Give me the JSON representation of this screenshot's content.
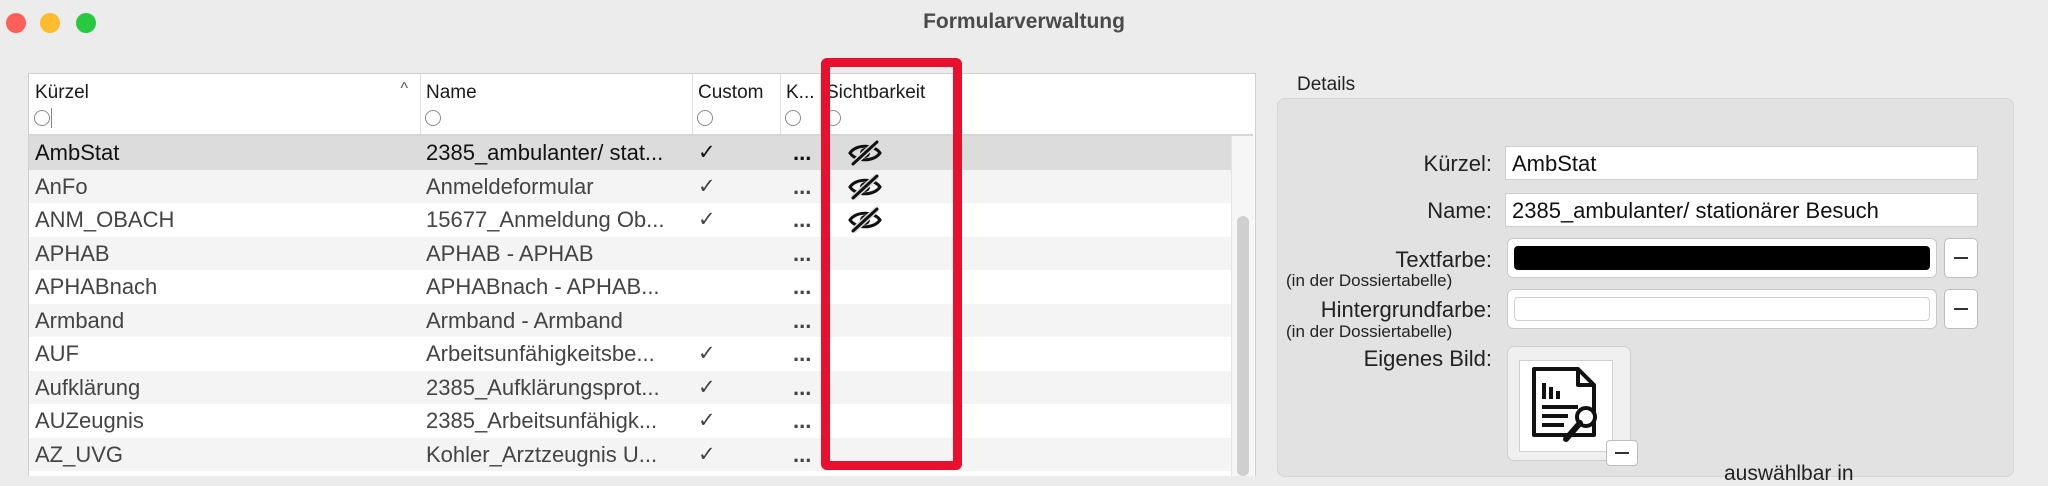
{
  "window": {
    "title": "Formularverwaltung"
  },
  "table": {
    "columns": [
      {
        "label": "Kürzel"
      },
      {
        "label": "Name"
      },
      {
        "label": "Custom"
      },
      {
        "label": "K..."
      },
      {
        "label": "Sichtbarkeit"
      }
    ],
    "rows": [
      {
        "kuerzel": "AmbStat",
        "name": "2385_ambulanter/ stat...",
        "custom": "✓",
        "k": "...",
        "hidden_icon": "eye-slash-icon"
      },
      {
        "kuerzel": "AnFo",
        "name": "Anmeldeformular",
        "custom": "✓",
        "k": "...",
        "hidden_icon": "eye-slash-icon"
      },
      {
        "kuerzel": "ANM_OBACH",
        "name": "15677_Anmeldung Ob...",
        "custom": "✓",
        "k": "...",
        "hidden_icon": "eye-slash-icon"
      },
      {
        "kuerzel": "APHAB",
        "name": "APHAB - APHAB",
        "custom": "",
        "k": "...",
        "hidden_icon": ""
      },
      {
        "kuerzel": "APHABnach",
        "name": "APHABnach - APHAB...",
        "custom": "",
        "k": "...",
        "hidden_icon": ""
      },
      {
        "kuerzel": "Armband",
        "name": "Armband - Armband",
        "custom": "",
        "k": "...",
        "hidden_icon": ""
      },
      {
        "kuerzel": "AUF",
        "name": "Arbeitsunfähigkeitsbe...",
        "custom": "✓",
        "k": "...",
        "hidden_icon": ""
      },
      {
        "kuerzel": "Aufklärung",
        "name": "2385_Aufklärungsprot...",
        "custom": "✓",
        "k": "...",
        "hidden_icon": ""
      },
      {
        "kuerzel": "AUZeugnis",
        "name": "2385_Arbeitsunfähigk...",
        "custom": "✓",
        "k": "...",
        "hidden_icon": ""
      },
      {
        "kuerzel": "AZ_UVG",
        "name": "Kohler_Arztzeugnis U...",
        "custom": "✓",
        "k": "...",
        "hidden_icon": ""
      }
    ]
  },
  "details": {
    "group_label": "Details",
    "kuerzel_label": "Kürzel:",
    "kuerzel_value": "AmbStat",
    "name_label": "Name:",
    "name_value": "2385_ambulanter/ stationärer Besuch",
    "textfarbe_label": "Textfarbe:",
    "textfarbe_sub": "(in der Dossiertabelle)",
    "textfarbe_color": "#000000",
    "hintergrund_label": "Hintergrundfarbe:",
    "hintergrund_sub": "(in der Dossiertabelle)",
    "hintergrund_color": "#ffffff",
    "bild_label": "Eigenes Bild:",
    "bild_icon": "document-chart-icon",
    "auswahl_text": "auswählbar in"
  },
  "colors": {
    "highlight": "#e8102f",
    "selected_row": "#dcdcdc"
  }
}
